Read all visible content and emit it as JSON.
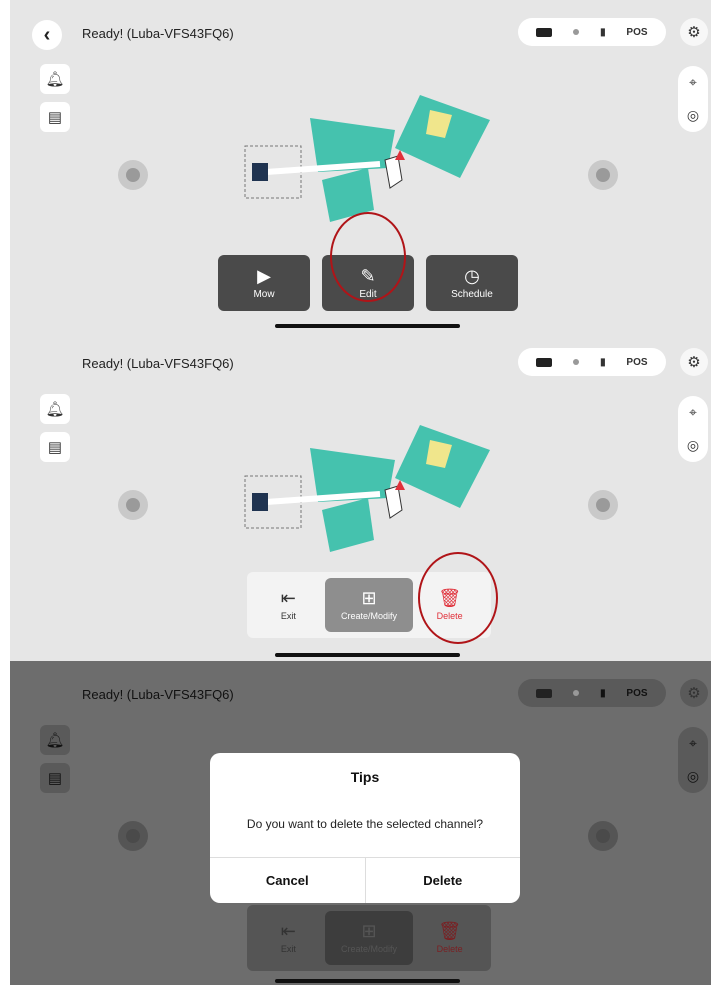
{
  "panels": [
    {
      "status_text": "Ready! (Luba-VFS43FQ6)",
      "back_icon": "chevron-left-icon",
      "pill_text": "POS",
      "toolbar": [
        {
          "label": "Mow",
          "icon": "play-icon"
        },
        {
          "label": "Edit",
          "icon": "edit-icon"
        },
        {
          "label": "Schedule",
          "icon": "clock-icon"
        }
      ]
    },
    {
      "status_text": "Ready! (Luba-VFS43FQ6)",
      "pill_text": "POS",
      "toolbar": [
        {
          "label": "Exit",
          "icon": "exit-icon"
        },
        {
          "label": "Create/Modify",
          "icon": "add-file-icon"
        },
        {
          "label": "Delete",
          "icon": "trash-icon"
        }
      ]
    },
    {
      "status_text": "Ready! (Luba-VFS43FQ6)",
      "pill_text": "POS",
      "toolbar": [
        {
          "label": "Exit",
          "icon": "exit-icon"
        },
        {
          "label": "Create/Modify",
          "icon": "add-file-icon"
        },
        {
          "label": "Delete",
          "icon": "trash-icon"
        }
      ],
      "dialog": {
        "title": "Tips",
        "message": "Do you want to delete the selected channel?",
        "cancel_label": "Cancel",
        "confirm_label": "Delete"
      }
    }
  ],
  "colors": {
    "map_green": "#45c2ae",
    "map_yellow": "#f0e68c",
    "highlight_circle": "#b01418",
    "delete_red": "#e0303a"
  }
}
